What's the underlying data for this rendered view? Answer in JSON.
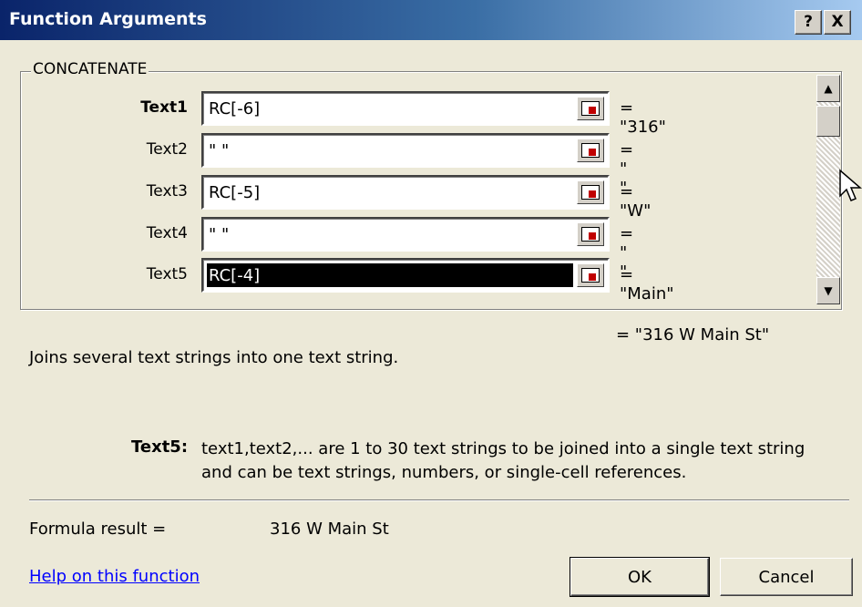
{
  "window": {
    "title": "Function Arguments",
    "help_button": "?",
    "close_button": "X"
  },
  "function_name": "CONCATENATE",
  "arguments": [
    {
      "label": "Text1",
      "value": "RC[-6]",
      "result": "= \"316\""
    },
    {
      "label": "Text2",
      "value": "\" \"",
      "result": "= \" \""
    },
    {
      "label": "Text3",
      "value": "RC[-5]",
      "result": "= \"W\""
    },
    {
      "label": "Text4",
      "value": "\" \"",
      "result": "= \" \""
    },
    {
      "label": "Text5",
      "value": "RC[-4]",
      "result": "= \"Main\""
    }
  ],
  "overall_result": "= \"316 W Main St\"",
  "description": "Joins several text strings into one text string.",
  "argument_help": {
    "label": "Text5:",
    "text": "text1,text2,... are 1 to 30 text strings to be joined into a single text string and can be text strings, numbers, or single-cell references."
  },
  "formula_result": {
    "label": "Formula result =",
    "value": "316 W Main St"
  },
  "help_link": "Help on this function",
  "buttons": {
    "ok": "OK",
    "cancel": "Cancel"
  },
  "colors": {
    "title_bar": "#0a246a",
    "dialog_bg": "#ece9d8",
    "link": "#0000ff"
  }
}
